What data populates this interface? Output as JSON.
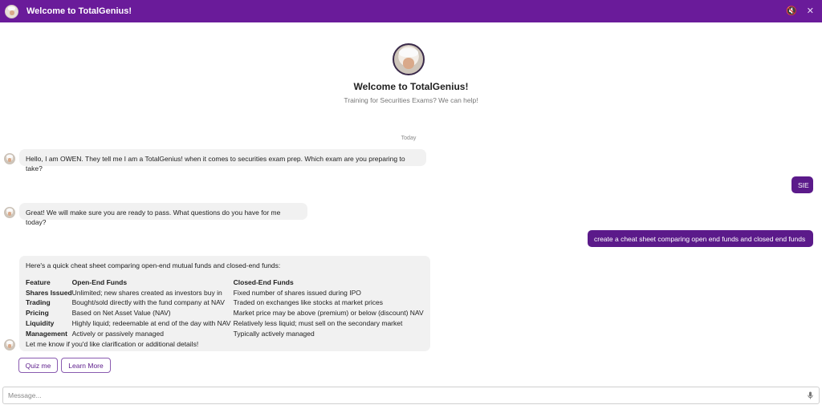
{
  "header": {
    "title": "Welcome to TotalGenius!",
    "mute_icon": "speaker-mute-icon",
    "close_icon": "close-icon",
    "mute_glyph": "🔇",
    "close_glyph": "✕",
    "bg_color": "#6a1b9a"
  },
  "welcome": {
    "title": "Welcome to TotalGenius!",
    "subtitle": "Training for Securities Exams? We can help!"
  },
  "day_separator": "Today",
  "messages": {
    "bot1": "Hello, I am OWEN.  They tell me I am a TotalGenius! when it comes to securities exam prep.  Which exam are you preparing to take?",
    "user1": "SIE",
    "bot2": "Great!  We will make sure you are ready to pass.  What questions do you have for me today?",
    "user2": "create a cheat sheet comparing open end funds and closed end funds"
  },
  "cheat_sheet": {
    "intro": "Here's a quick cheat sheet comparing open-end mutual funds and closed-end funds:",
    "headers": [
      "Feature",
      "Open-End Funds",
      "Closed-End Funds"
    ],
    "rows": [
      [
        "Shares Issued",
        "Unlimited; new shares created as investors buy in",
        "Fixed number of shares issued during IPO"
      ],
      [
        "Trading",
        "Bought/sold directly with the fund company at NAV",
        "Traded on exchanges like stocks at market prices"
      ],
      [
        "Pricing",
        "Based on Net Asset Value (NAV)",
        "Market price may be above (premium) or below (discount) NAV"
      ],
      [
        "Liquidity",
        "Highly liquid; redeemable at end of the day with NAV",
        "Relatively less liquid; must sell on the secondary market"
      ],
      [
        "Management",
        "Actively or passively managed",
        "Typically actively managed"
      ]
    ],
    "outro": "Let me know if you'd like clarification or additional details!"
  },
  "quick_replies": [
    "Quiz me",
    "Learn More"
  ],
  "composer": {
    "placeholder": "Message...",
    "mic_icon": "microphone-icon"
  },
  "colors": {
    "brand": "#6a1b9a",
    "user_bubble": "#5b1a8a",
    "bot_bubble": "#f1f1f1"
  }
}
